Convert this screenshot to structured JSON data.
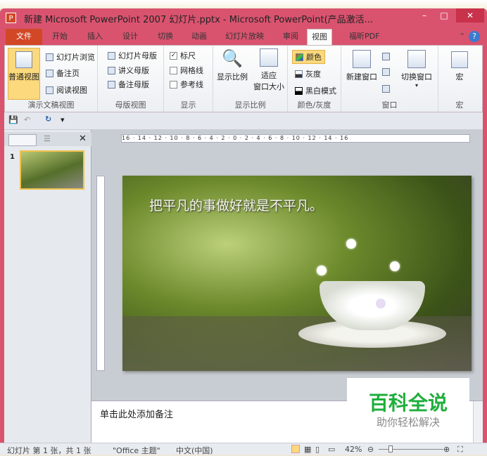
{
  "window": {
    "title": "新建 Microsoft PowerPoint 2007 幻灯片.pptx - Microsoft PowerPoint(产品激活...",
    "app_icon": "P",
    "minimize": "–",
    "maximize": "□",
    "close": "✕"
  },
  "tabs": [
    "文件",
    "开始",
    "插入",
    "设计",
    "切换",
    "动画",
    "幻灯片放映",
    "审阅",
    "视图",
    "福昕PDF"
  ],
  "ribbon": {
    "presentation_views": {
      "label": "演示文稿视图",
      "normal": "普通视图",
      "sorter": "幻灯片浏览",
      "notes_page": "备注页",
      "reading": "阅读视图"
    },
    "master_views": {
      "label": "母版视图",
      "slide_master": "幻灯片母版",
      "handout_master": "讲义母版",
      "notes_master": "备注母版"
    },
    "show": {
      "label": "显示",
      "ruler": "标尺",
      "gridlines": "网格线",
      "guides": "参考线",
      "ruler_checked": true,
      "gridlines_checked": false,
      "guides_checked": false
    },
    "zoom": {
      "label": "显示比例",
      "zoom": "显示比例",
      "fit_line1": "适应",
      "fit_line2": "窗口大小"
    },
    "color": {
      "label": "颜色/灰度",
      "color": "颜色",
      "grayscale": "灰度",
      "bw": "黑白模式"
    },
    "window": {
      "label": "窗口",
      "new_window": "新建窗口",
      "switch": "切换窗口"
    },
    "macros": {
      "label": "宏",
      "macros": "宏"
    }
  },
  "qat": {
    "save": "💾",
    "undo": "↶",
    "redo": "↻",
    "more": "▾"
  },
  "thumbs": {
    "number": "1",
    "close": "✕"
  },
  "ruler": "16 · 14 · 12 · 10 · 8 · 6 · 4 · 2 · 0 · 2 · 4 · 6 · 8 · 10 · 12 · 14 · 16",
  "slide": {
    "title": "把平凡的事做好就是不平凡。"
  },
  "notes": {
    "placeholder": "单击此处添加备注"
  },
  "watermark": {
    "brand": "百科全说",
    "slogan": "助你轻松解决"
  },
  "status": {
    "slide": "幻灯片 第 1 张，共 1 张",
    "theme": "\"Office 主题\"",
    "language": "中文(中国)",
    "zoom": "42%"
  }
}
